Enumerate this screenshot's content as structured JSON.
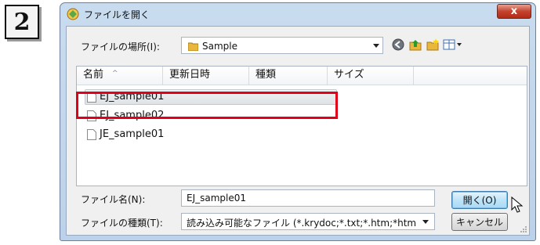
{
  "step_number": "2",
  "dialog": {
    "title": "ファイルを開く",
    "close_label": "x",
    "location_label": "ファイルの場所(I):",
    "location_value": "Sample",
    "columns": [
      "名前",
      "更新日時",
      "種類",
      "サイズ"
    ],
    "files": [
      {
        "name": "EJ_sample01",
        "selected": true
      },
      {
        "name": "EJ_sample02",
        "selected": false
      },
      {
        "name": "JE_sample01",
        "selected": false
      }
    ],
    "filename_label": "ファイル名(N):",
    "filename_value": "EJ_sample01",
    "filetype_label": "ファイルの種類(T):",
    "filetype_value": "読み込み可能なファイル (*.krydoc;*.txt;*.htm;*htm",
    "open_button": "開く(O)",
    "cancel_button": "キャンセル"
  },
  "colors": {
    "highlight": "#e0001a",
    "title_bar": "#c9dcef",
    "close_button": "#c4432e"
  },
  "icons": [
    "app-icon",
    "folder-icon",
    "back-icon",
    "up-folder-icon",
    "new-folder-icon",
    "view-menu-icon",
    "document-icon",
    "mouse-cursor-icon"
  ]
}
